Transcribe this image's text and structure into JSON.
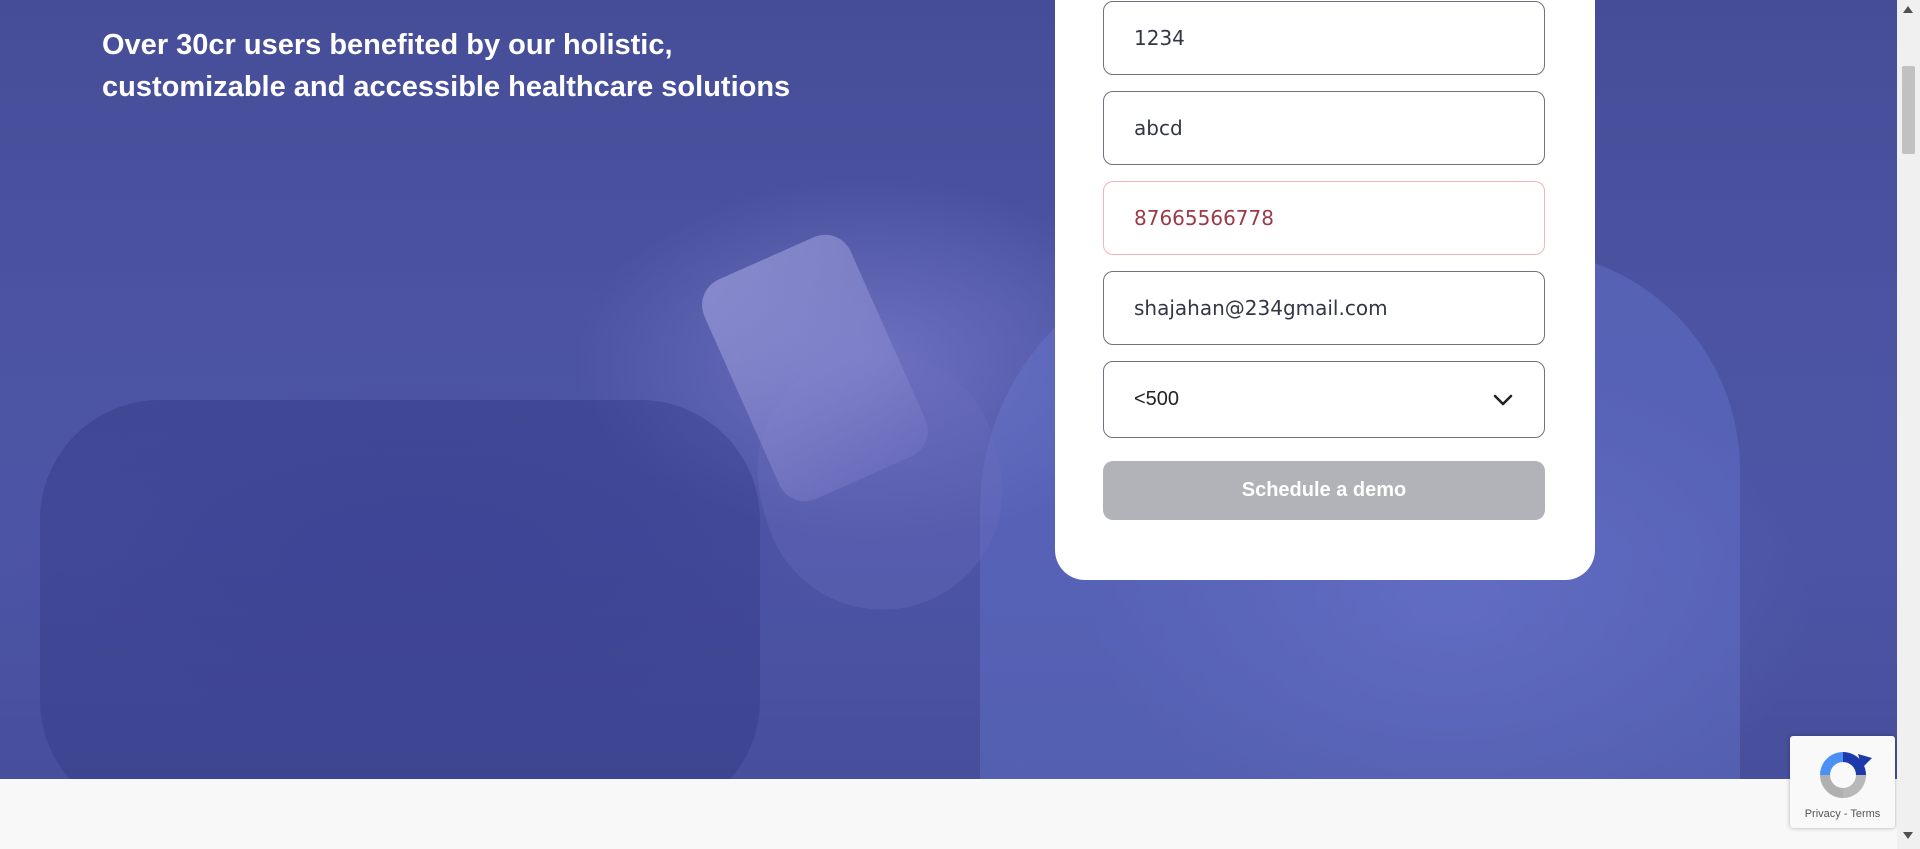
{
  "hero": {
    "heading": "Over 30cr users benefited by our holistic, customizable and accessible healthcare solutions"
  },
  "form": {
    "fields": [
      {
        "value": "1234",
        "state": "normal"
      },
      {
        "value": "abcd",
        "state": "normal"
      },
      {
        "value": "87665566778",
        "state": "error"
      },
      {
        "value": "shajahan@234gmail.com",
        "state": "normal"
      }
    ],
    "select": {
      "value": "<500"
    },
    "submit_label": "Schedule a demo"
  },
  "recaptcha": {
    "privacy": "Privacy",
    "separator": " - ",
    "terms": "Terms"
  },
  "colors": {
    "hero_overlay": "#4a51a1",
    "button_disabled": "#b2b2b9",
    "error_border": "#f0b4bc",
    "error_text": "#9b3a46"
  }
}
